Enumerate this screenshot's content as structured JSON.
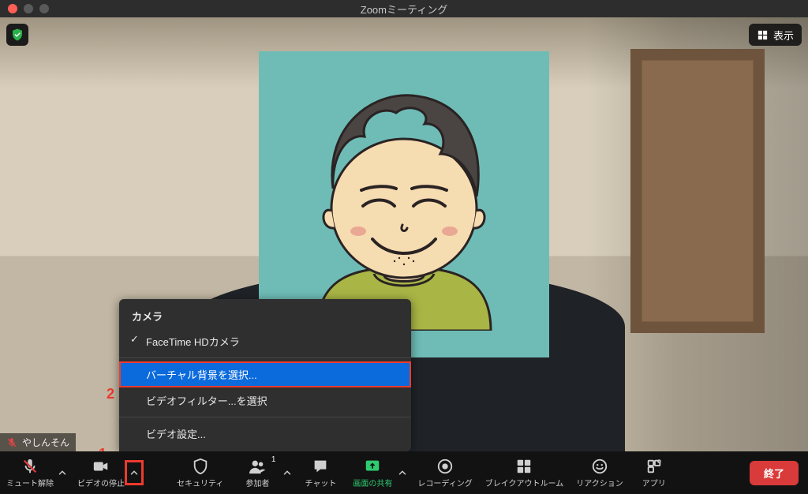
{
  "window": {
    "title": "Zoomミーティング"
  },
  "top": {
    "view_label": "表示"
  },
  "participant": {
    "name": "やしんそん"
  },
  "video_menu": {
    "section_camera": "カメラ",
    "camera_option": "FaceTime HDカメラ",
    "virtual_bg": "バーチャル背景を選択...",
    "video_filter": "ビデオフィルター...を選択",
    "video_settings": "ビデオ設定..."
  },
  "annotations": {
    "one": "1",
    "two": "2"
  },
  "toolbar": {
    "mute": "ミュート解除",
    "video": "ビデオの停止",
    "security": "セキュリティ",
    "participants": "参加者",
    "participants_count": "1",
    "chat": "チャット",
    "share": "画面の共有",
    "record": "レコーディング",
    "breakout": "ブレイクアウトルーム",
    "reactions": "リアクション",
    "apps": "アプリ",
    "end": "終了"
  }
}
